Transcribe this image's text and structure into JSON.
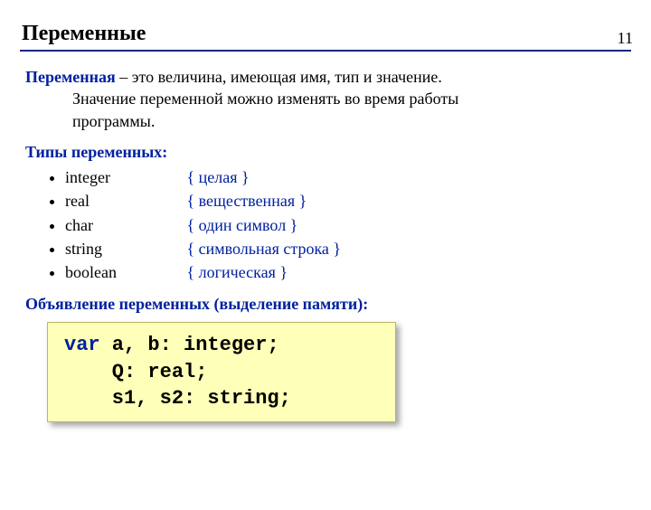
{
  "page_number": "11",
  "title": "Переменные",
  "definition": {
    "term": "Переменная",
    "dash": " – ",
    "first_line_rest": "это величина, имеющая имя, тип и значение.",
    "cont1": "Значение переменной можно изменять во время работы",
    "cont2": "программы."
  },
  "types_label": "Типы переменных:",
  "types": [
    {
      "name": "integer",
      "comment": "{ целая }"
    },
    {
      "name": "real",
      "comment": "{ вещественная }"
    },
    {
      "name": "char",
      "comment": "{ один символ }"
    },
    {
      "name": "string",
      "comment": "{ символьная строка }"
    },
    {
      "name": "boolean",
      "comment": "{ логическая }"
    }
  ],
  "decl_label": "Объявление переменных (выделение памяти):",
  "code": {
    "kw_var": "var",
    "line1_rest": " a, b: integer;",
    "line2": "    Q: real;",
    "line3": "    s1, s2: string;"
  }
}
